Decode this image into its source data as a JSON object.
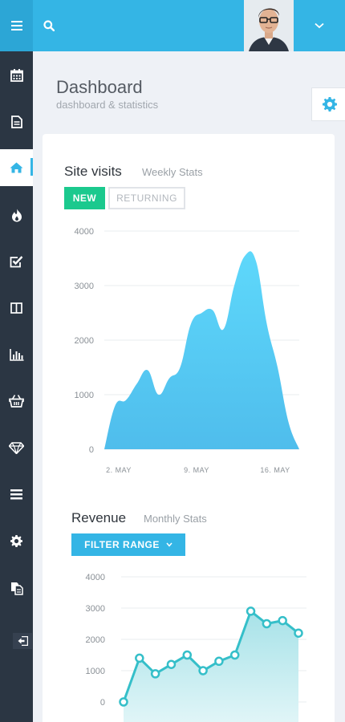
{
  "topbar": {
    "menu_icon": "hamburger-icon",
    "search_icon": "search-icon",
    "dropdown_icon": "chevron-down-icon",
    "accent": "#34b5e5"
  },
  "sidebar": {
    "items": [
      {
        "icon": "calendar-icon"
      },
      {
        "icon": "document-icon"
      },
      {
        "icon": "home-icon",
        "active": true
      },
      {
        "icon": "fire-icon"
      },
      {
        "icon": "checkbox-icon"
      },
      {
        "icon": "columns-icon"
      },
      {
        "icon": "bar-chart-icon"
      },
      {
        "icon": "basket-icon"
      },
      {
        "icon": "diamond-icon"
      },
      {
        "icon": "list-icon"
      },
      {
        "icon": "gear-icon"
      },
      {
        "icon": "copy-icon"
      }
    ],
    "logout_icon": "logout-icon"
  },
  "header": {
    "title": "Dashboard",
    "subtitle": "dashboard & statistics",
    "settings_icon": "gear-icon"
  },
  "site_visits": {
    "title": "Site visits",
    "subtitle": "Weekly Stats",
    "btn_new": "NEW",
    "btn_returning": "RETURNING"
  },
  "revenue": {
    "title": "Revenue",
    "subtitle": "Monthly Stats",
    "btn_filter": "FILTER RANGE"
  },
  "chart_data": [
    {
      "type": "area",
      "title": "",
      "ylim": [
        0,
        4000
      ],
      "yticks": [
        "4000",
        "3000",
        "2000",
        "1000",
        "0"
      ],
      "xticks": [
        "2. MAY",
        "9. MAY",
        "16. MAY"
      ],
      "x": [
        0,
        1,
        2,
        3,
        4,
        5,
        6,
        7,
        8,
        9,
        10,
        11,
        12,
        13,
        14,
        15,
        16,
        17,
        18
      ],
      "values": [
        0,
        800,
        900,
        1200,
        1450,
        1000,
        1300,
        1500,
        2300,
        2500,
        2550,
        2200,
        3000,
        3550,
        3450,
        2300,
        1500,
        500,
        0
      ],
      "color": "#5dcaf2",
      "grid": true
    },
    {
      "type": "line",
      "title": "",
      "ylim": [
        0,
        4000
      ],
      "yticks": [
        "4000",
        "3000",
        "2000",
        "1000",
        "0"
      ],
      "values": [
        0,
        1400,
        900,
        1200,
        1500,
        1000,
        1300,
        1500,
        2900,
        2500,
        2600,
        2200
      ],
      "color": "#35bfc9",
      "fill": "#b7e7ec",
      "grid": true
    }
  ]
}
